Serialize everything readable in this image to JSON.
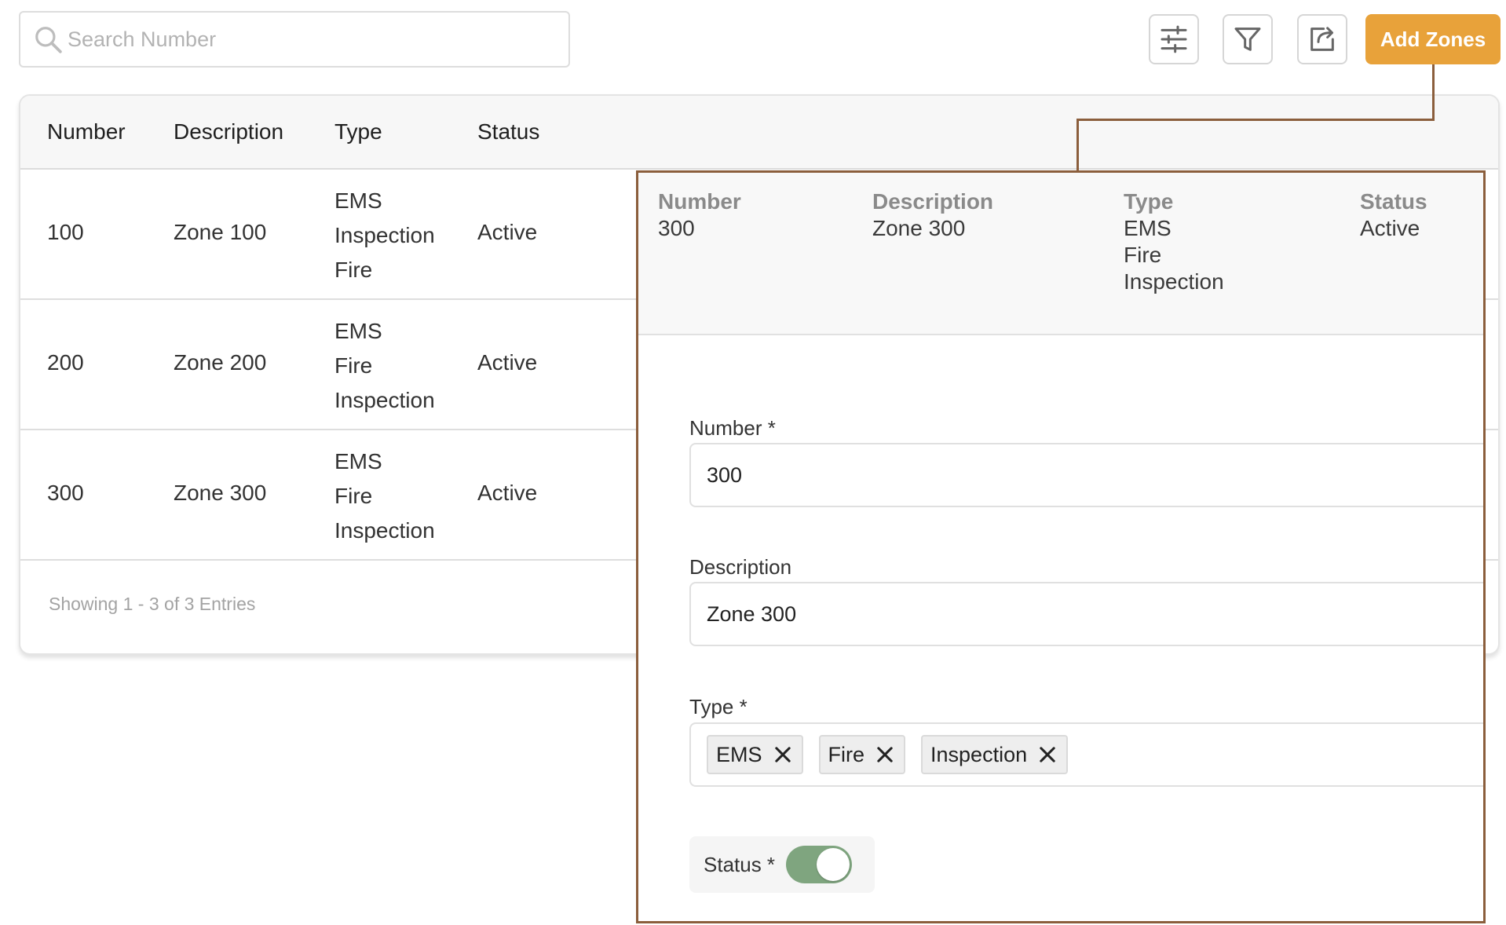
{
  "search": {
    "placeholder": "Search Number"
  },
  "toolbar": {
    "add_label": "Add Zones"
  },
  "table": {
    "headers": [
      "Number",
      "Description",
      "Type",
      "Status"
    ],
    "rows": [
      {
        "number": "100",
        "description": "Zone 100",
        "types": [
          "EMS",
          "Inspection",
          "Fire"
        ],
        "status": "Active"
      },
      {
        "number": "200",
        "description": "Zone 200",
        "types": [
          "EMS",
          "Fire",
          "Inspection"
        ],
        "status": "Active"
      },
      {
        "number": "300",
        "description": "Zone 300",
        "types": [
          "EMS",
          "Fire",
          "Inspection"
        ],
        "status": "Active"
      }
    ],
    "footer": "Showing 1 - 3 of 3 Entries"
  },
  "detail": {
    "summary": {
      "number_label": "Number",
      "number": "300",
      "description_label": "Description",
      "description": "Zone 300",
      "type_label": "Type",
      "types": [
        "EMS",
        "Fire",
        "Inspection"
      ],
      "status_label": "Status",
      "status": "Active"
    },
    "form": {
      "number_label": "Number *",
      "number_value": "300",
      "description_label": "Description",
      "description_value": "Zone 300",
      "type_label": "Type *",
      "chips": [
        "EMS",
        "Fire",
        "Inspection"
      ],
      "status_label": "Status *",
      "status_on": true
    }
  },
  "colors": {
    "accent": "#e8a23a",
    "panel_border": "#8b5e3c",
    "toggle_on": "#7fa57f"
  }
}
